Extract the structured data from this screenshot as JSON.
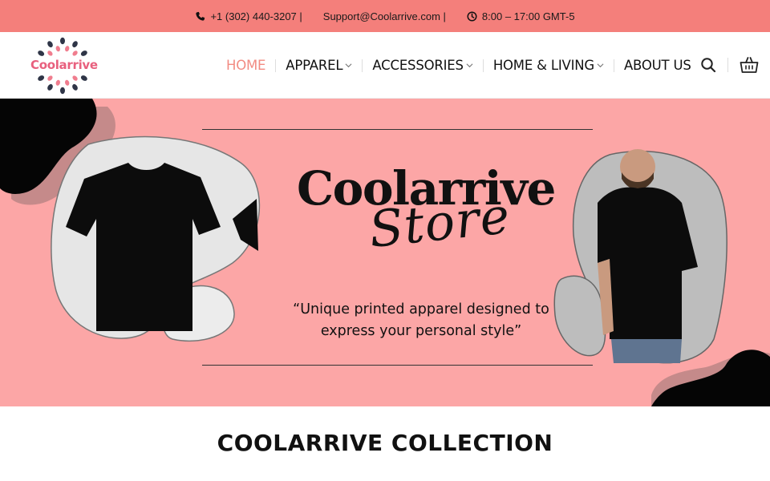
{
  "topbar": {
    "phone": "+1 (302) 440-3207 |",
    "email": "Support@Coolarrive.com |",
    "hours": "8:00 – 17:00 GMT-5",
    "background": "#f47f7b"
  },
  "header": {
    "logo_text": "Coolarrive",
    "nav": [
      {
        "label": "HOME",
        "active": true
      },
      {
        "label": "APPAREL",
        "dropdown": true
      },
      {
        "label": "ACCESSORIES",
        "dropdown": true
      },
      {
        "label": "HOME & LIVING",
        "dropdown": true
      },
      {
        "label": "ABOUT US"
      }
    ],
    "icons": [
      "search-icon",
      "basket-icon"
    ]
  },
  "hero": {
    "title": "Coolarrive",
    "script": "Store",
    "tagline": "“Unique printed apparel designed to express your personal style”",
    "background": "#fca6a6"
  },
  "collection": {
    "title": "COOLARRIVE COLLECTION"
  },
  "colors": {
    "accent": "#f28b82",
    "brand_pink": "#e8607e"
  }
}
